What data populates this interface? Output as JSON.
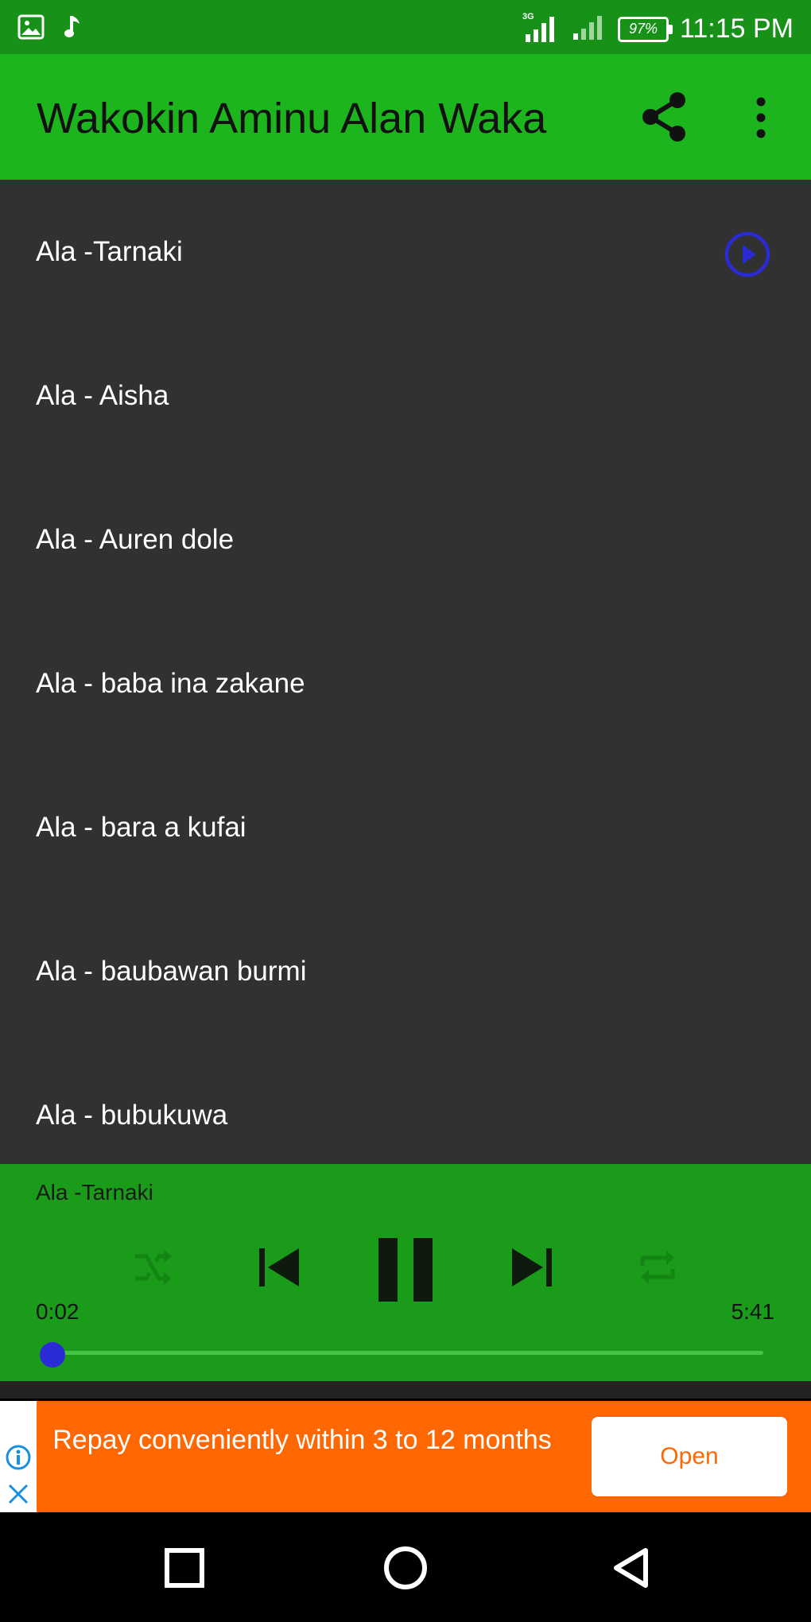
{
  "status_bar": {
    "network_label": "3G",
    "battery": "97%",
    "time": "11:15 PM"
  },
  "app_bar": {
    "title": "Wakokin Aminu Alan Waka"
  },
  "tracks": [
    {
      "title": "Ala -Tarnaki"
    },
    {
      "title": "Ala - Aisha"
    },
    {
      "title": "Ala - Auren dole"
    },
    {
      "title": "Ala - baba ina zakane"
    },
    {
      "title": "Ala - bara a kufai"
    },
    {
      "title": "Ala - baubawan burmi"
    },
    {
      "title": "Ala - bubukuwa"
    }
  ],
  "player": {
    "now_playing": "Ala -Tarnaki",
    "elapsed": "0:02",
    "duration": "5:41",
    "progress_fraction": 0.006
  },
  "ad": {
    "text": "Repay conveniently within 3 to 12 months",
    "button_label": "Open"
  },
  "colors": {
    "status_bar": "#189118",
    "app_bar": "#1db51d",
    "list_bg": "#313131",
    "player_bg": "#1a9c1a",
    "accent_blue": "#2b2bd6",
    "ad_orange": "#fe6702"
  }
}
